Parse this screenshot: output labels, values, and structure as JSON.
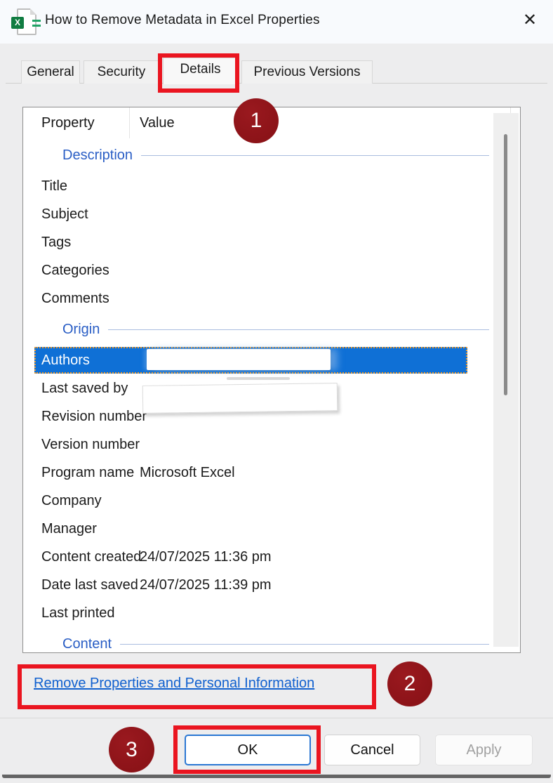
{
  "window": {
    "title": "How to Remove Metadata in Excel Properties",
    "close_label": "✕",
    "icon_letter": "X"
  },
  "tabs": [
    {
      "label": "General",
      "active": false
    },
    {
      "label": "Security",
      "active": false
    },
    {
      "label": "Details",
      "active": true,
      "annotated": true
    },
    {
      "label": "Previous Versions",
      "active": false
    }
  ],
  "list": {
    "columns": [
      "Property",
      "Value"
    ],
    "rows": [
      {
        "type": "section",
        "key": "description",
        "label": "Description"
      },
      {
        "type": "item",
        "key": "title",
        "label": "Title",
        "value": ""
      },
      {
        "type": "item",
        "key": "subject",
        "label": "Subject",
        "value": ""
      },
      {
        "type": "item",
        "key": "tags",
        "label": "Tags",
        "value": ""
      },
      {
        "type": "item",
        "key": "categories",
        "label": "Categories",
        "value": ""
      },
      {
        "type": "item",
        "key": "comments",
        "label": "Comments",
        "value": ""
      },
      {
        "type": "section",
        "key": "origin",
        "label": "Origin"
      },
      {
        "type": "item",
        "key": "authors",
        "label": "Authors",
        "value": "",
        "selected": true,
        "redacted": "authors"
      },
      {
        "type": "item",
        "key": "last-saved-by",
        "label": "Last saved by",
        "value": "",
        "redacted": "lsb"
      },
      {
        "type": "item",
        "key": "revision-number",
        "label": "Revision number",
        "value": ""
      },
      {
        "type": "item",
        "key": "version-number",
        "label": "Version number",
        "value": ""
      },
      {
        "type": "item",
        "key": "program-name",
        "label": "Program name",
        "value": "Microsoft Excel"
      },
      {
        "type": "item",
        "key": "company",
        "label": "Company",
        "value": ""
      },
      {
        "type": "item",
        "key": "manager",
        "label": "Manager",
        "value": ""
      },
      {
        "type": "item",
        "key": "content-created",
        "label": "Content created",
        "value": "24/07/2025 11:36 pm"
      },
      {
        "type": "item",
        "key": "date-last-saved",
        "label": "Date last saved",
        "value": "24/07/2025 11:39 pm"
      },
      {
        "type": "item",
        "key": "last-printed",
        "label": "Last printed",
        "value": ""
      },
      {
        "type": "section",
        "key": "content",
        "label": "Content"
      }
    ]
  },
  "link": {
    "label": "Remove Properties and Personal Information"
  },
  "buttons": {
    "ok": "OK",
    "cancel": "Cancel",
    "apply": "Apply"
  },
  "annotations": {
    "badges": [
      {
        "label": "1"
      },
      {
        "label": "2"
      },
      {
        "label": "3"
      }
    ]
  },
  "colors": {
    "accent_red": "#ea1520",
    "badge_maroon": "#8c1318",
    "selection_blue": "#0f70d6",
    "link_blue": "#1060cf",
    "section_blue": "#2a5ec5"
  }
}
